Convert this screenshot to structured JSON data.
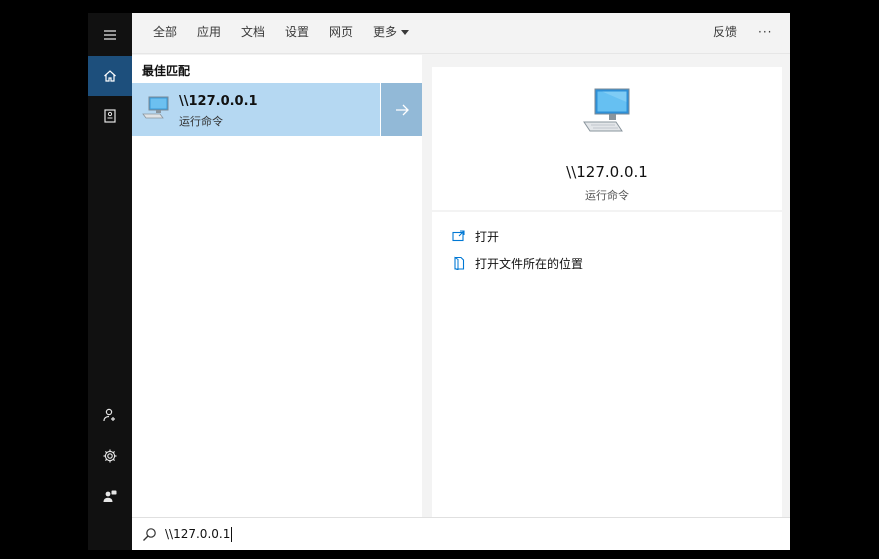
{
  "tabs": [
    "全部",
    "应用",
    "文档",
    "设置",
    "网页",
    "更多"
  ],
  "topbar": {
    "feedback": "反馈",
    "more": "···"
  },
  "results": {
    "section_title": "最佳匹配",
    "best_match": {
      "title": "\\\\127.0.0.1",
      "subtitle": "运行命令"
    }
  },
  "detail": {
    "title": "\\\\127.0.0.1",
    "subtitle": "运行命令",
    "actions": [
      {
        "label": "打开",
        "icon": "open-icon"
      },
      {
        "label": "打开文件所在的位置",
        "icon": "file-location-icon"
      }
    ]
  },
  "search": {
    "value": "\\\\127.0.0.1"
  },
  "rail": {
    "icons": [
      "menu-icon",
      "home-icon",
      "notebook-icon",
      "user-add-icon",
      "gear-icon",
      "feedback-person-icon"
    ]
  },
  "colors": {
    "accent": "#0078d4",
    "selection": "#b5d8f2",
    "rail_active": "#1d4f7c"
  }
}
